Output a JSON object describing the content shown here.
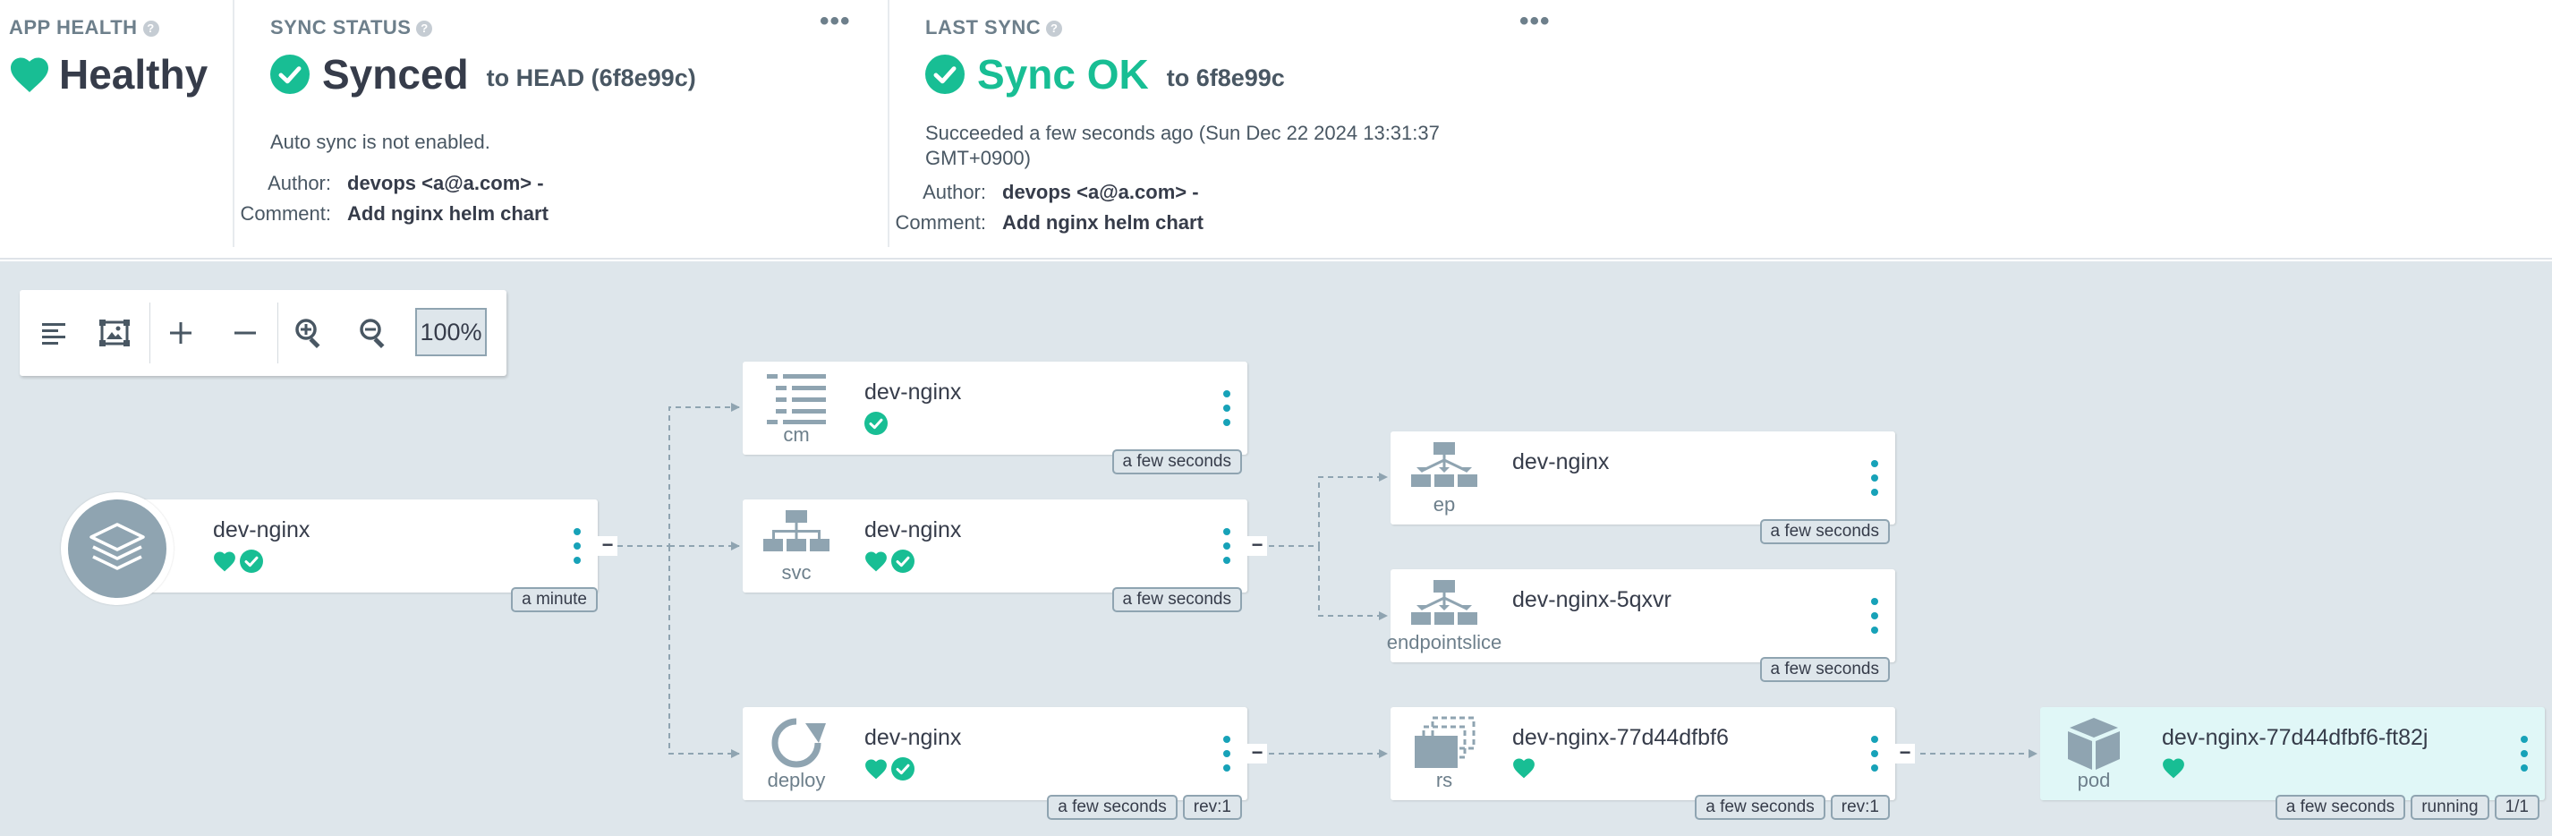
{
  "app_health": {
    "title": "APP HEALTH",
    "status": "Healthy",
    "help_icon": "?"
  },
  "sync_status": {
    "title": "SYNC STATUS",
    "help_icon": "?",
    "menu": "•••",
    "status": "Synced",
    "target": "to HEAD (6f8e99c)",
    "auto_sync": "Auto sync is not enabled.",
    "author_label": "Author:",
    "author": "devops <a@a.com> -",
    "comment_label": "Comment:",
    "comment": "Add nginx helm chart"
  },
  "last_sync": {
    "title": "LAST SYNC",
    "help_icon": "?",
    "menu": "•••",
    "status": "Sync OK",
    "target": "to 6f8e99c",
    "succeeded_line1": "Succeeded a few seconds ago (Sun Dec 22 2024 13:31:37",
    "succeeded_line2": "GMT+0900)",
    "author_label": "Author:",
    "author": "devops <a@a.com> -",
    "comment_label": "Comment:",
    "comment": "Add nginx helm chart"
  },
  "toolbar": {
    "zoom": "100%"
  },
  "colors": {
    "healthy": "#18be94",
    "synced": "#18be94",
    "menu_dots": "#17a2b8",
    "icon_gray": "#8fa4b1",
    "graph_bg": "#dee6eb"
  },
  "nodes": {
    "app": {
      "name": "dev-nginx",
      "tags": [
        "a minute"
      ]
    },
    "cm": {
      "name": "dev-nginx",
      "kind": "cm",
      "tags": [
        "a few seconds"
      ]
    },
    "svc": {
      "name": "dev-nginx",
      "kind": "svc",
      "tags": [
        "a few seconds"
      ]
    },
    "deploy": {
      "name": "dev-nginx",
      "kind": "deploy",
      "tags": [
        "a few seconds",
        "rev:1"
      ]
    },
    "ep": {
      "name": "dev-nginx",
      "kind": "ep",
      "tags": [
        "a few seconds"
      ]
    },
    "endpointslice": {
      "name": "dev-nginx-5qxvr",
      "kind": "endpointslice",
      "tags": [
        "a few seconds"
      ]
    },
    "rs": {
      "name": "dev-nginx-77d44dfbf6",
      "kind": "rs",
      "tags": [
        "a few seconds",
        "rev:1"
      ]
    },
    "pod": {
      "name": "dev-nginx-77d44dfbf6-ft82j",
      "kind": "pod",
      "tags": [
        "a few seconds",
        "running",
        "1/1"
      ]
    }
  },
  "collapse_symbol": "−"
}
